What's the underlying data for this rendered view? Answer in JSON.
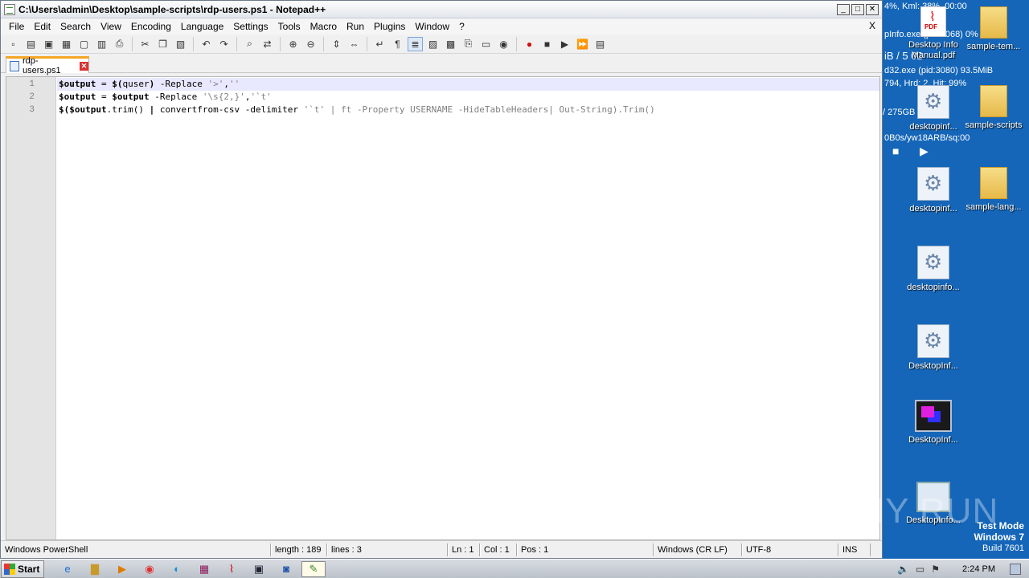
{
  "window": {
    "title": "C:\\Users\\admin\\Desktop\\sample-scripts\\rdp-users.ps1 - Notepad++",
    "minimize": "_",
    "maximize": "□",
    "close": "✕"
  },
  "menu": {
    "items": [
      "File",
      "Edit",
      "Search",
      "View",
      "Encoding",
      "Language",
      "Settings",
      "Tools",
      "Macro",
      "Run",
      "Plugins",
      "Window",
      "?"
    ],
    "close": "X"
  },
  "toolbar": {
    "buttons": [
      "new-file",
      "open-file",
      "save",
      "save-all",
      "close",
      "close-all",
      "print",
      "cut",
      "copy",
      "paste",
      "undo",
      "redo",
      "find",
      "replace",
      "zoom-in",
      "zoom-out",
      "sync-vertical",
      "sync-horizontal",
      "word-wrap",
      "show-all-chars",
      "indent-guide",
      "doc-map",
      "function-list",
      "folder-workspace",
      "monitoring",
      "record-macro",
      "stop-macro",
      "play-macro",
      "run-macro-multiple",
      "save-macro"
    ]
  },
  "tab": {
    "label": "rdp-users.ps1",
    "close": "✕"
  },
  "editor": {
    "line_numbers": [
      "1",
      "2",
      "3"
    ],
    "lines": [
      [
        {
          "t": "$output",
          "c": "var"
        },
        {
          "t": " = ",
          "c": "kw"
        },
        {
          "t": "$(",
          "c": "var"
        },
        {
          "t": "quser",
          "c": "cmd"
        },
        {
          "t": ") ",
          "c": "var"
        },
        {
          "t": "-Replace ",
          "c": "kw"
        },
        {
          "t": "'>'",
          "c": "str"
        },
        {
          "t": ",",
          "c": "kw"
        },
        {
          "t": "''",
          "c": "str"
        }
      ],
      [
        {
          "t": "$output",
          "c": "var"
        },
        {
          "t": " = ",
          "c": "kw"
        },
        {
          "t": "$output",
          "c": "var"
        },
        {
          "t": " -Replace ",
          "c": "kw"
        },
        {
          "t": "'\\s{2,}'",
          "c": "str"
        },
        {
          "t": ",",
          "c": "kw"
        },
        {
          "t": "'`t'",
          "c": "str"
        }
      ],
      [
        {
          "t": "$($output",
          "c": "var"
        },
        {
          "t": ".trim() ",
          "c": "kw"
        },
        {
          "t": "|",
          "c": "var"
        },
        {
          "t": " convertfrom-csv -delimiter ",
          "c": "kw"
        },
        {
          "t": "'`t' | ft -Property USERNAME -HideTableHeaders| Out-String).Trim()",
          "c": "dim"
        }
      ]
    ]
  },
  "status": {
    "file_type": "Windows PowerShell",
    "length": "length : 189",
    "lines": "lines : 3",
    "ln": "Ln : 1",
    "col": "Col : 1",
    "pos": "Pos : 1",
    "eol": "Windows (CR LF)",
    "encoding": "UTF-8",
    "mode": "INS"
  },
  "desktop": {
    "overlay": [
      "4%, Kml: 38%, 00:00",
      "pInfo.exe (pid:3068) 0%",
      "iB / 5 02",
      "d32.exe (pid:3080) 93.5MiB",
      "794, Hrd: 2, Hit: 99%",
      "/ 275GB",
      "0B0s/yw18ARB/sq:00"
    ],
    "icons": [
      {
        "label": "Desktop Info Manual.pdf",
        "kind": "pdf"
      },
      {
        "label": "sample-tem...",
        "kind": "folder"
      },
      {
        "label": "desktopinf...",
        "kind": "gear"
      },
      {
        "label": "sample-scripts",
        "kind": "folder"
      },
      {
        "label": "desktopinf...",
        "kind": "gear"
      },
      {
        "label": "sample-lang...",
        "kind": "folder"
      },
      {
        "label": "desktopinfo...",
        "kind": "gear"
      },
      {
        "label": "DesktopInf...",
        "kind": "gear"
      },
      {
        "label": "DesktopInf...",
        "kind": "monitor"
      },
      {
        "label": "DesktopInfo...",
        "kind": "screen"
      }
    ],
    "watermark": "ANY RUN",
    "test_mode": {
      "line1": "Test Mode",
      "line2": "Windows 7",
      "line3": "Build 7601"
    }
  },
  "taskbar": {
    "start": "Start",
    "apps": [
      "ie",
      "explorer",
      "media-player",
      "chrome",
      "edge",
      "winrar",
      "acrobat",
      "desktopinfo",
      "outlook",
      "notepadpp"
    ],
    "clock": "2:24 PM"
  }
}
